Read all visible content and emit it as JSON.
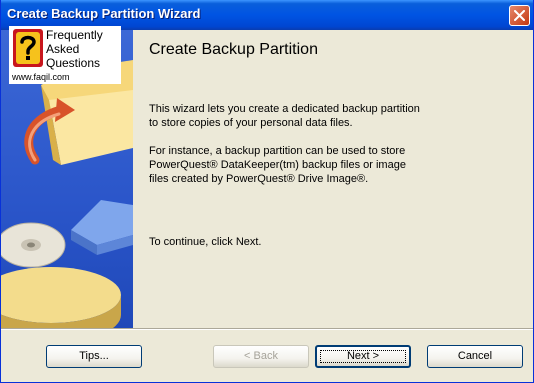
{
  "window": {
    "title": "Create Backup Partition Wizard"
  },
  "icons": {
    "close": "close-icon",
    "faq": "question-mark-icon",
    "folder": "folder-icon",
    "arrow": "curved-arrow-icon",
    "disc": "disc-icon",
    "drive": "drive-icon"
  },
  "colors": {
    "titlebar": "#0054e3",
    "close": "#c4380f",
    "sidebar": "#2a55c9",
    "dialog": "#ece9d8",
    "faq_badge": "#c8161d"
  },
  "logo": {
    "line1": "Frequently",
    "line2": "Asked",
    "line3": "Questions",
    "url": "www.faqil.com"
  },
  "content": {
    "heading": "Create Backup Partition",
    "para1_line1": "This wizard lets you create a dedicated backup partition",
    "para1_line2": "to store copies of your personal data files.",
    "para2_line1": "For instance, a backup partition can  be used to store",
    "para2_line2": "PowerQuest® DataKeeper(tm) backup files or image",
    "para2_line3": "files created by PowerQuest® Drive Image®.",
    "para3": "To continue, click Next."
  },
  "buttons": {
    "tips": "Tips...",
    "back": "< Back",
    "next": "Next >",
    "cancel": "Cancel"
  }
}
